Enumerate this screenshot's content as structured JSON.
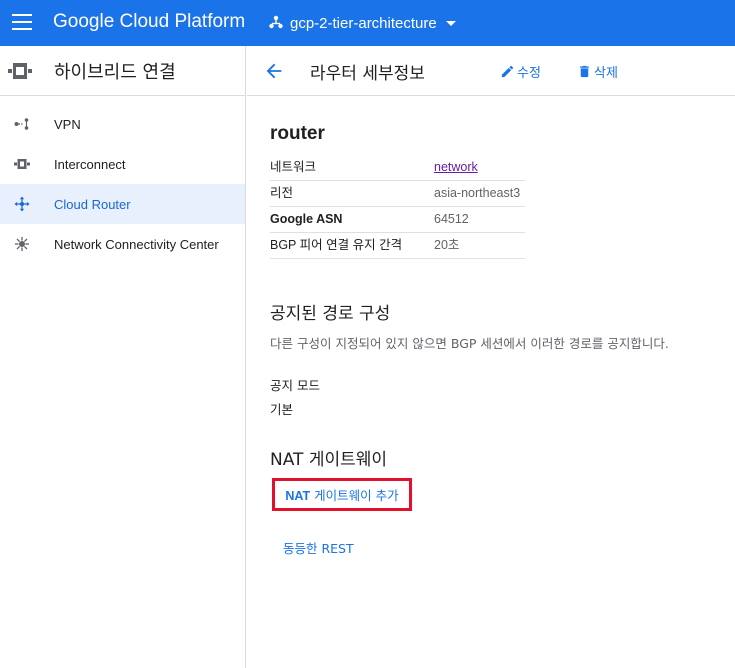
{
  "app": {
    "brand": "Google Cloud Platform",
    "project_name": "gcp-2-tier-architecture"
  },
  "sidebar": {
    "title": "하이브리드 연결",
    "items": [
      {
        "label": "VPN",
        "icon": "vpn-icon",
        "active": false
      },
      {
        "label": "Interconnect",
        "icon": "interconnect-icon",
        "active": false
      },
      {
        "label": "Cloud Router",
        "icon": "cloud-router-icon",
        "active": true
      },
      {
        "label": "Network Connectivity Center",
        "icon": "network-connectivity-icon",
        "active": false
      }
    ]
  },
  "header": {
    "title": "라우터 세부정보",
    "edit_label": "수정",
    "delete_label": "삭제"
  },
  "router": {
    "name": "router",
    "properties": [
      {
        "key": "네트워크",
        "value": "network",
        "link": true
      },
      {
        "key": "리전",
        "value": "asia-northeast3"
      },
      {
        "key": "Google ASN",
        "value": "64512"
      },
      {
        "key": "BGP 피어 연결 유지 간격",
        "value": "20초"
      }
    ]
  },
  "advertised": {
    "title": "공지된 경로 구성",
    "description": "다른 구성이 지정되어 있지 않으면 BGP 세션에서 이러한 경로를 공지합니다.",
    "mode_label": "공지 모드",
    "mode_value": "기본"
  },
  "nat": {
    "title": "NAT 게이트웨이",
    "add_prefix": "NAT",
    "add_suffix": " 게이트웨이 추가"
  },
  "rest_link": "동등한 REST",
  "colors": {
    "topbar": "#1a73e8",
    "accent": "#1a73e8",
    "highlight_box": "#e3102b",
    "active_bg": "#e8f0fe",
    "visited_link": "#681da8"
  }
}
